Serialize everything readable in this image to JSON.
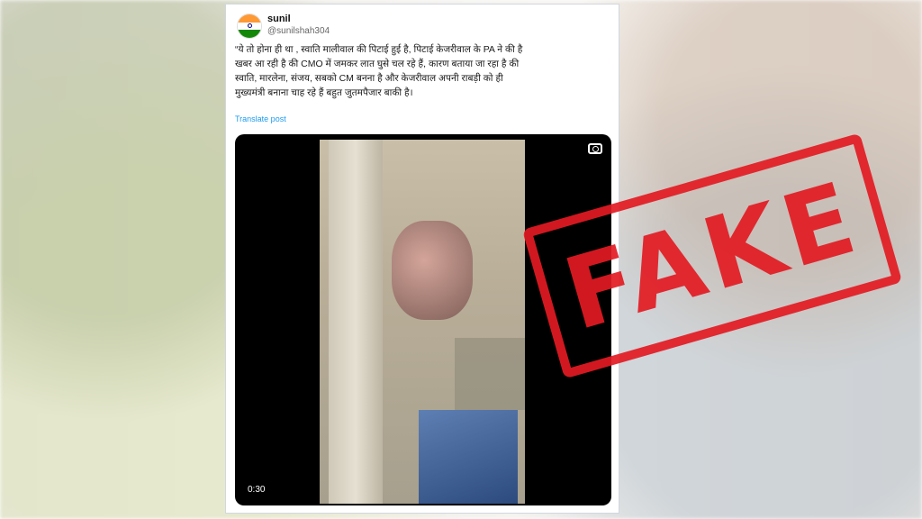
{
  "tweet": {
    "name": "sunil",
    "handle": "@sunilshah304",
    "text": "“ये तो होना ही था , स्वाति मालीवाल की पिटाई हुई है, पिटाई केजरीवाल के PA ने की है\nखबर आ रही है की CMO में जमकर लात घुसे चल रहे हैं, कारण बताया जा रहा है की\nस्वाति, मारलेना, संजय, सबको CM बनना है और केजरीवाल अपनी राबड़ी को ही\nमुख्यमंत्री बनाना चाह रहे हैं बहुत जुतमपैजार बाकी है।",
    "translate_label": "Translate post",
    "video_duration": "0:30"
  },
  "stamp_text": "FAKE",
  "colors": {
    "stamp": "#e31b23",
    "link": "#1d9bf0"
  }
}
